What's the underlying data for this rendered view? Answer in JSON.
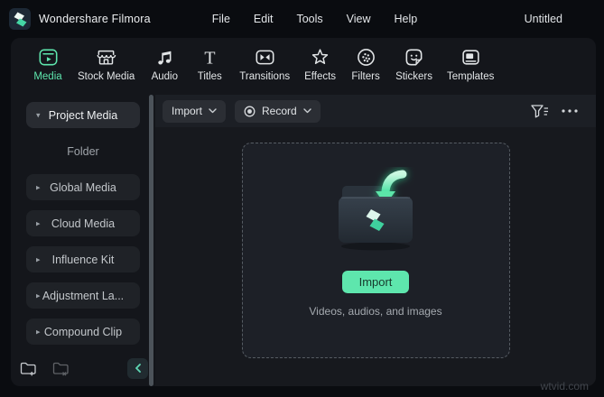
{
  "menu_bar": {
    "app_name": "Wondershare Filmora",
    "logo_icon": "filmora-diamond-icon",
    "items": [
      {
        "label": "File"
      },
      {
        "label": "Edit"
      },
      {
        "label": "Tools"
      },
      {
        "label": "View"
      },
      {
        "label": "Help"
      }
    ],
    "window_title": "Untitled"
  },
  "tabs": {
    "items": [
      {
        "label": "Media",
        "icon": "media-icon",
        "active": true
      },
      {
        "label": "Stock Media",
        "icon": "stock-media-icon",
        "active": false
      },
      {
        "label": "Audio",
        "icon": "audio-icon",
        "active": false
      },
      {
        "label": "Titles",
        "icon": "titles-icon",
        "active": false
      },
      {
        "label": "Transitions",
        "icon": "transitions-icon",
        "active": false
      },
      {
        "label": "Effects",
        "icon": "effects-icon",
        "active": false
      },
      {
        "label": "Filters",
        "icon": "filters-icon",
        "active": false
      },
      {
        "label": "Stickers",
        "icon": "stickers-icon",
        "active": false
      },
      {
        "label": "Templates",
        "icon": "templates-icon",
        "active": false
      }
    ]
  },
  "sidebar": {
    "items": [
      {
        "label": "Project Media",
        "type": "pill",
        "active": true,
        "caret": "down"
      },
      {
        "label": "Folder",
        "type": "text"
      },
      {
        "label": "Global Media",
        "type": "pill",
        "caret": "right"
      },
      {
        "label": "Cloud Media",
        "type": "pill",
        "caret": "right"
      },
      {
        "label": "Influence Kit",
        "type": "pill",
        "caret": "right"
      },
      {
        "label": "Adjustment La...",
        "type": "pill",
        "caret": "right"
      },
      {
        "label": "Compound Clip",
        "type": "pill",
        "caret": "right"
      }
    ],
    "footer": {
      "new_folder_icon": "new-folder-icon",
      "delete_folder_icon": "delete-folder-icon",
      "collapse_icon": "chevron-left-icon"
    }
  },
  "toolbar": {
    "import_dropdown": {
      "label": "Import",
      "icon": "chevron-down-icon"
    },
    "record_dropdown": {
      "label": "Record",
      "icon": "record-icon",
      "caret": "chevron-down-icon"
    },
    "filter_icon": "filter-icon",
    "more_icon": "ellipsis-icon"
  },
  "dropzone": {
    "illustration": "import-folder-with-arrow-icon",
    "import_button_label": "Import",
    "caption": "Videos, audios, and images"
  },
  "watermark": {
    "text": "wtvid.com"
  },
  "colors": {
    "accent": "#5ee6ad",
    "active_tab": "#6ce0bb",
    "accent_dark_text": "#17392c",
    "panel_bg": "#14161b",
    "content_bg": "#17191e",
    "toolbar_bg": "#1c1f25",
    "frame_bg": "#0a0c10"
  }
}
